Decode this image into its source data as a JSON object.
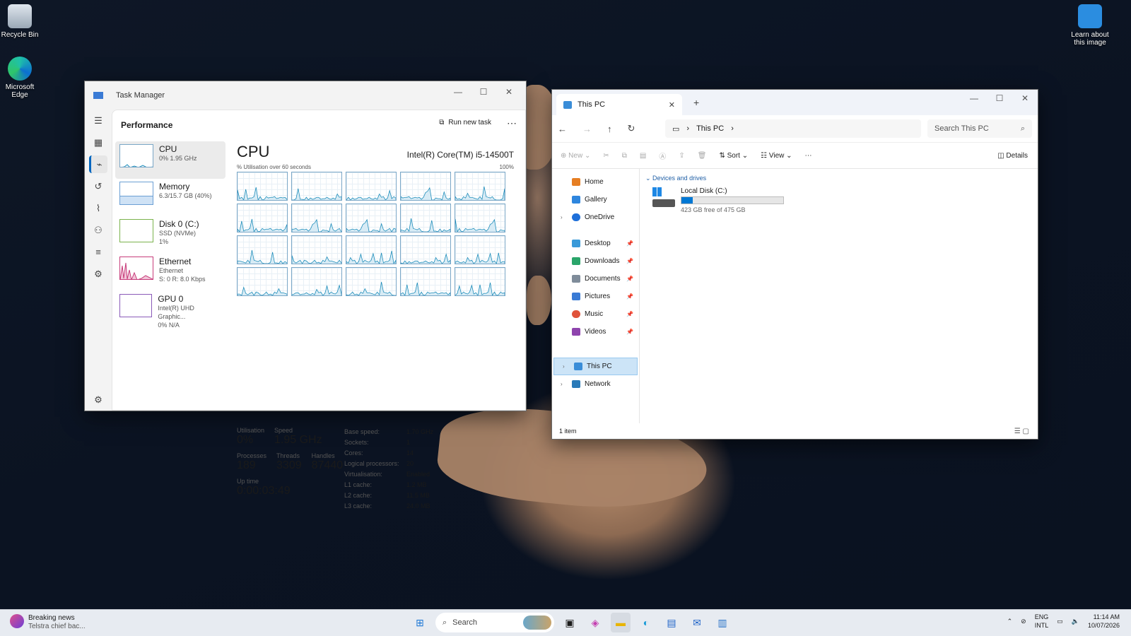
{
  "desktop": {
    "icons": [
      {
        "label": "Recycle Bin"
      },
      {
        "label": "Microsoft Edge"
      }
    ],
    "learn": "Learn about this image"
  },
  "taskmanager": {
    "title": "Task Manager",
    "section": "Performance",
    "run_new_task": "Run new task",
    "list": [
      {
        "name": "CPU",
        "sub1": "0% 1.95 GHz",
        "sub2": ""
      },
      {
        "name": "Memory",
        "sub1": "6.3/15.7 GB (40%)",
        "sub2": ""
      },
      {
        "name": "Disk 0 (C:)",
        "sub1": "SSD (NVMe)",
        "sub2": "1%"
      },
      {
        "name": "Ethernet",
        "sub1": "Ethernet",
        "sub2": "S: 0 R: 8.0 Kbps"
      },
      {
        "name": "GPU 0",
        "sub1": "Intel(R) UHD Graphic...",
        "sub2": "0% N/A"
      }
    ],
    "detail": {
      "title": "CPU",
      "model": "Intel(R) Core(TM) i5-14500T",
      "caption": "% Utilisation over 60 seconds",
      "max": "100%",
      "utilisation_label": "Utilisation",
      "utilisation": "0%",
      "speed_label": "Speed",
      "speed": "1.95 GHz",
      "processes_label": "Processes",
      "processes": "189",
      "threads_label": "Threads",
      "threads": "3309",
      "handles_label": "Handles",
      "handles": "87440",
      "uptime_label": "Up time",
      "uptime": "0:00:03:49",
      "specs": [
        [
          "Base speed:",
          "1.70 GHz"
        ],
        [
          "Sockets:",
          "1"
        ],
        [
          "Cores:",
          "14"
        ],
        [
          "Logical processors:",
          "20"
        ],
        [
          "Virtualisation:",
          "Enabled"
        ],
        [
          "L1 cache:",
          "1.2 MB"
        ],
        [
          "L2 cache:",
          "11.5 MB"
        ],
        [
          "L3 cache:",
          "24.0 MB"
        ]
      ]
    }
  },
  "explorer": {
    "tab": "This PC",
    "address": "This PC",
    "search_placeholder": "Search This PC",
    "commands": {
      "new": "New",
      "sort": "Sort",
      "view": "View",
      "details": "Details"
    },
    "sidebar": [
      "Home",
      "Gallery",
      "OneDrive",
      "Desktop",
      "Downloads",
      "Documents",
      "Pictures",
      "Music",
      "Videos",
      "This PC",
      "Network"
    ],
    "group": "Devices and drives",
    "drive": {
      "name": "Local Disk (C:)",
      "free": "423 GB free of 475 GB",
      "used_fraction": 0.11
    },
    "status": "1 item"
  },
  "taskbar": {
    "news_title": "Breaking news",
    "news_sub": "Telstra chief bac...",
    "search": "Search",
    "lang1": "ENG",
    "lang2": "INTL",
    "time": "11:14 AM",
    "date": "10/07/2026"
  }
}
